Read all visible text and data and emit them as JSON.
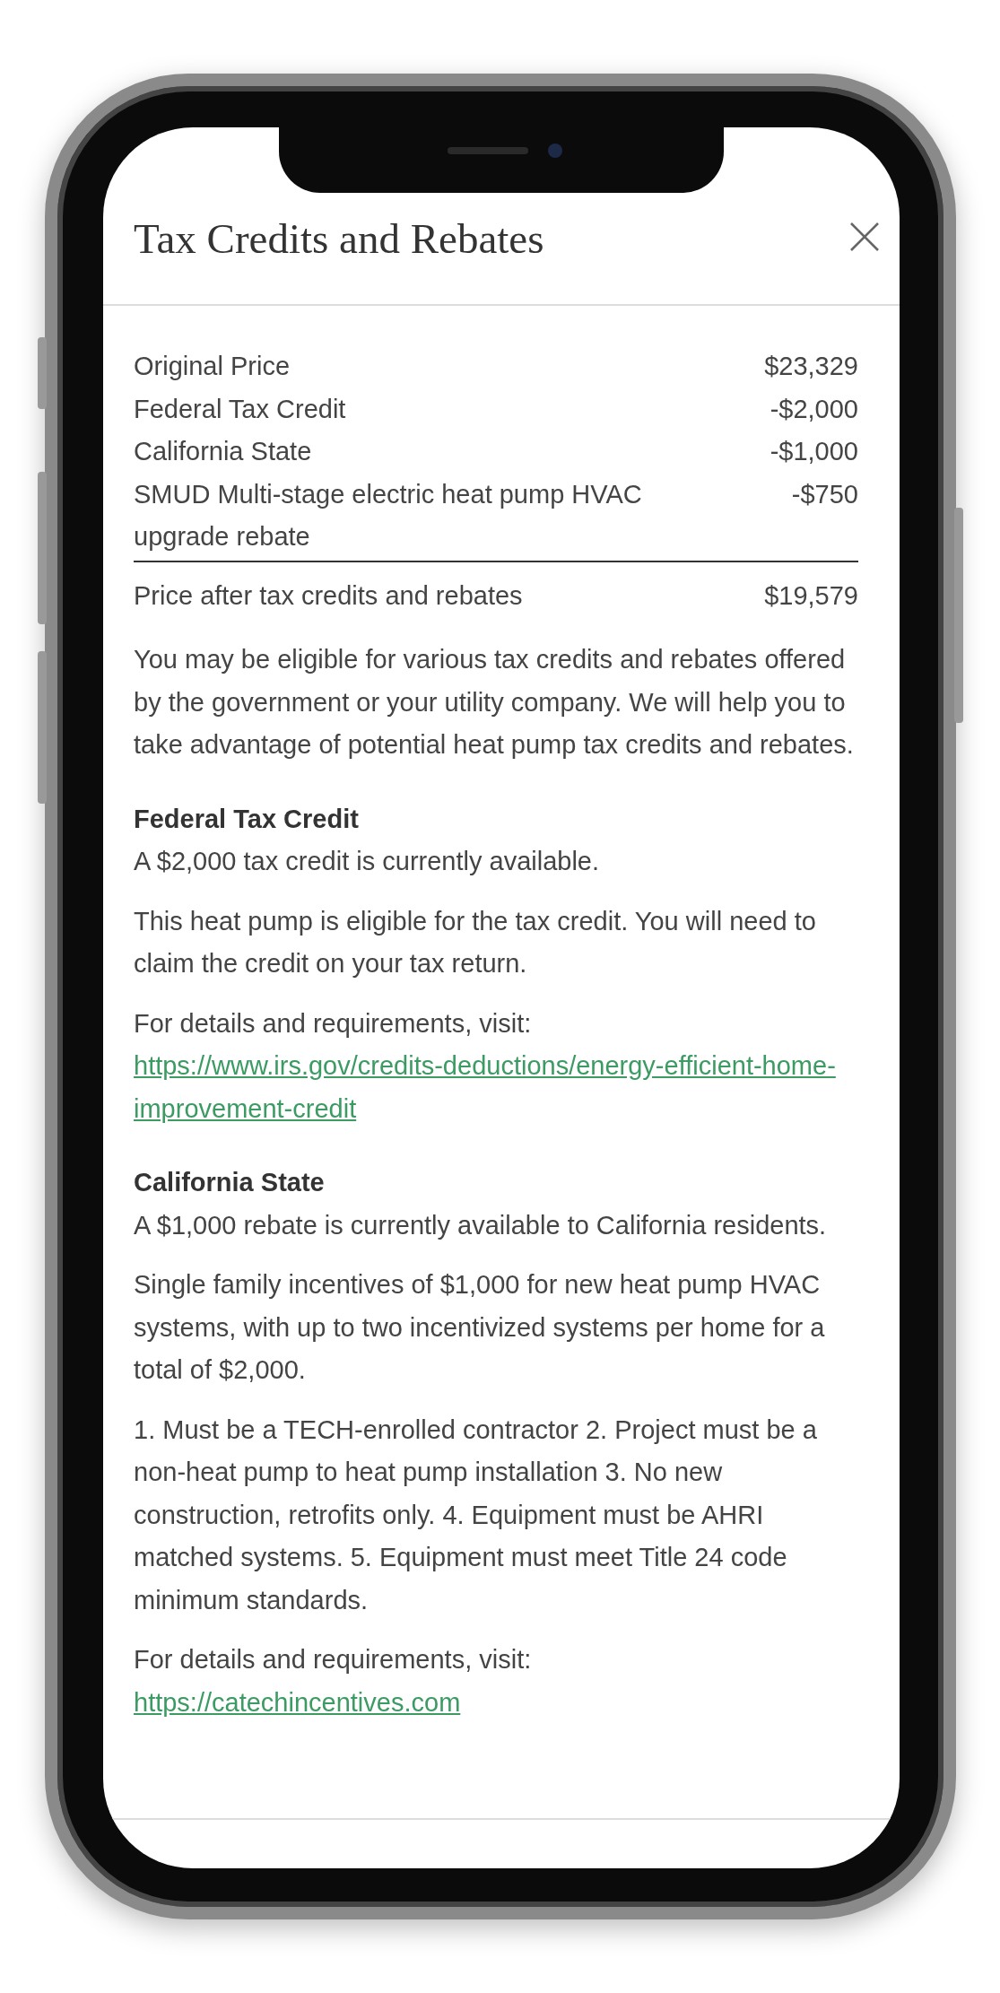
{
  "dialog": {
    "title": "Tax Credits and Rebates"
  },
  "price_rows": [
    {
      "label": "Original Price",
      "amount": "$23,329"
    },
    {
      "label": "Federal Tax Credit",
      "amount": "-$2,000"
    },
    {
      "label": "California State",
      "amount": "-$1,000"
    },
    {
      "label": "SMUD Multi-stage electric heat pump HVAC upgrade rebate",
      "amount": "-$750"
    }
  ],
  "total": {
    "label": "Price after tax credits and rebates",
    "amount": "$19,579"
  },
  "intro": "You may be eligible for various tax credits and rebates offered by the government or your utility company. We will help you to take advantage of potential heat pump tax credits and rebates.",
  "sections": [
    {
      "heading": "Federal Tax Credit",
      "paragraphs": [
        "A $2,000 tax credit is currently available.",
        "This heat pump is eligible for the tax credit. You will need to claim the credit on your tax return."
      ],
      "link_intro": "For details and requirements, visit:",
      "link": "https://www.irs.gov/credits-deductions/energy-efficient-home-improvement-credit"
    },
    {
      "heading": "California State",
      "paragraphs": [
        "A $1,000 rebate is currently available to California residents.",
        "Single family incentives of $1,000 for new heat pump HVAC systems, with up to two incentivized systems per home for a total of $2,000.",
        "1. Must be a TECH-enrolled contractor 2. Project must be a non-heat pump to heat pump installation 3. No new construction, retrofits only. 4. Equipment must be AHRI matched systems. 5. Equipment must meet Title 24 code minimum standards."
      ],
      "link_intro": "For details and requirements, visit:",
      "link": "https://catechincentives.com"
    }
  ]
}
